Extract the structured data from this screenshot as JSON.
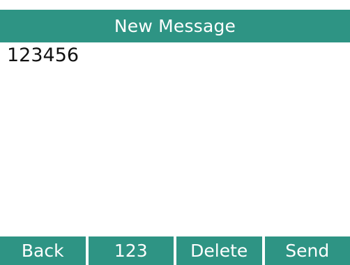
{
  "header": {
    "title": "New Message"
  },
  "message": {
    "text": "123456"
  },
  "softkeys": {
    "back_label": "Back",
    "input_mode_label": "123",
    "delete_label": "Delete",
    "send_label": "Send"
  },
  "colors": {
    "accent": "#2e9484",
    "text_on_accent": "#ffffff",
    "background": "#ffffff"
  }
}
